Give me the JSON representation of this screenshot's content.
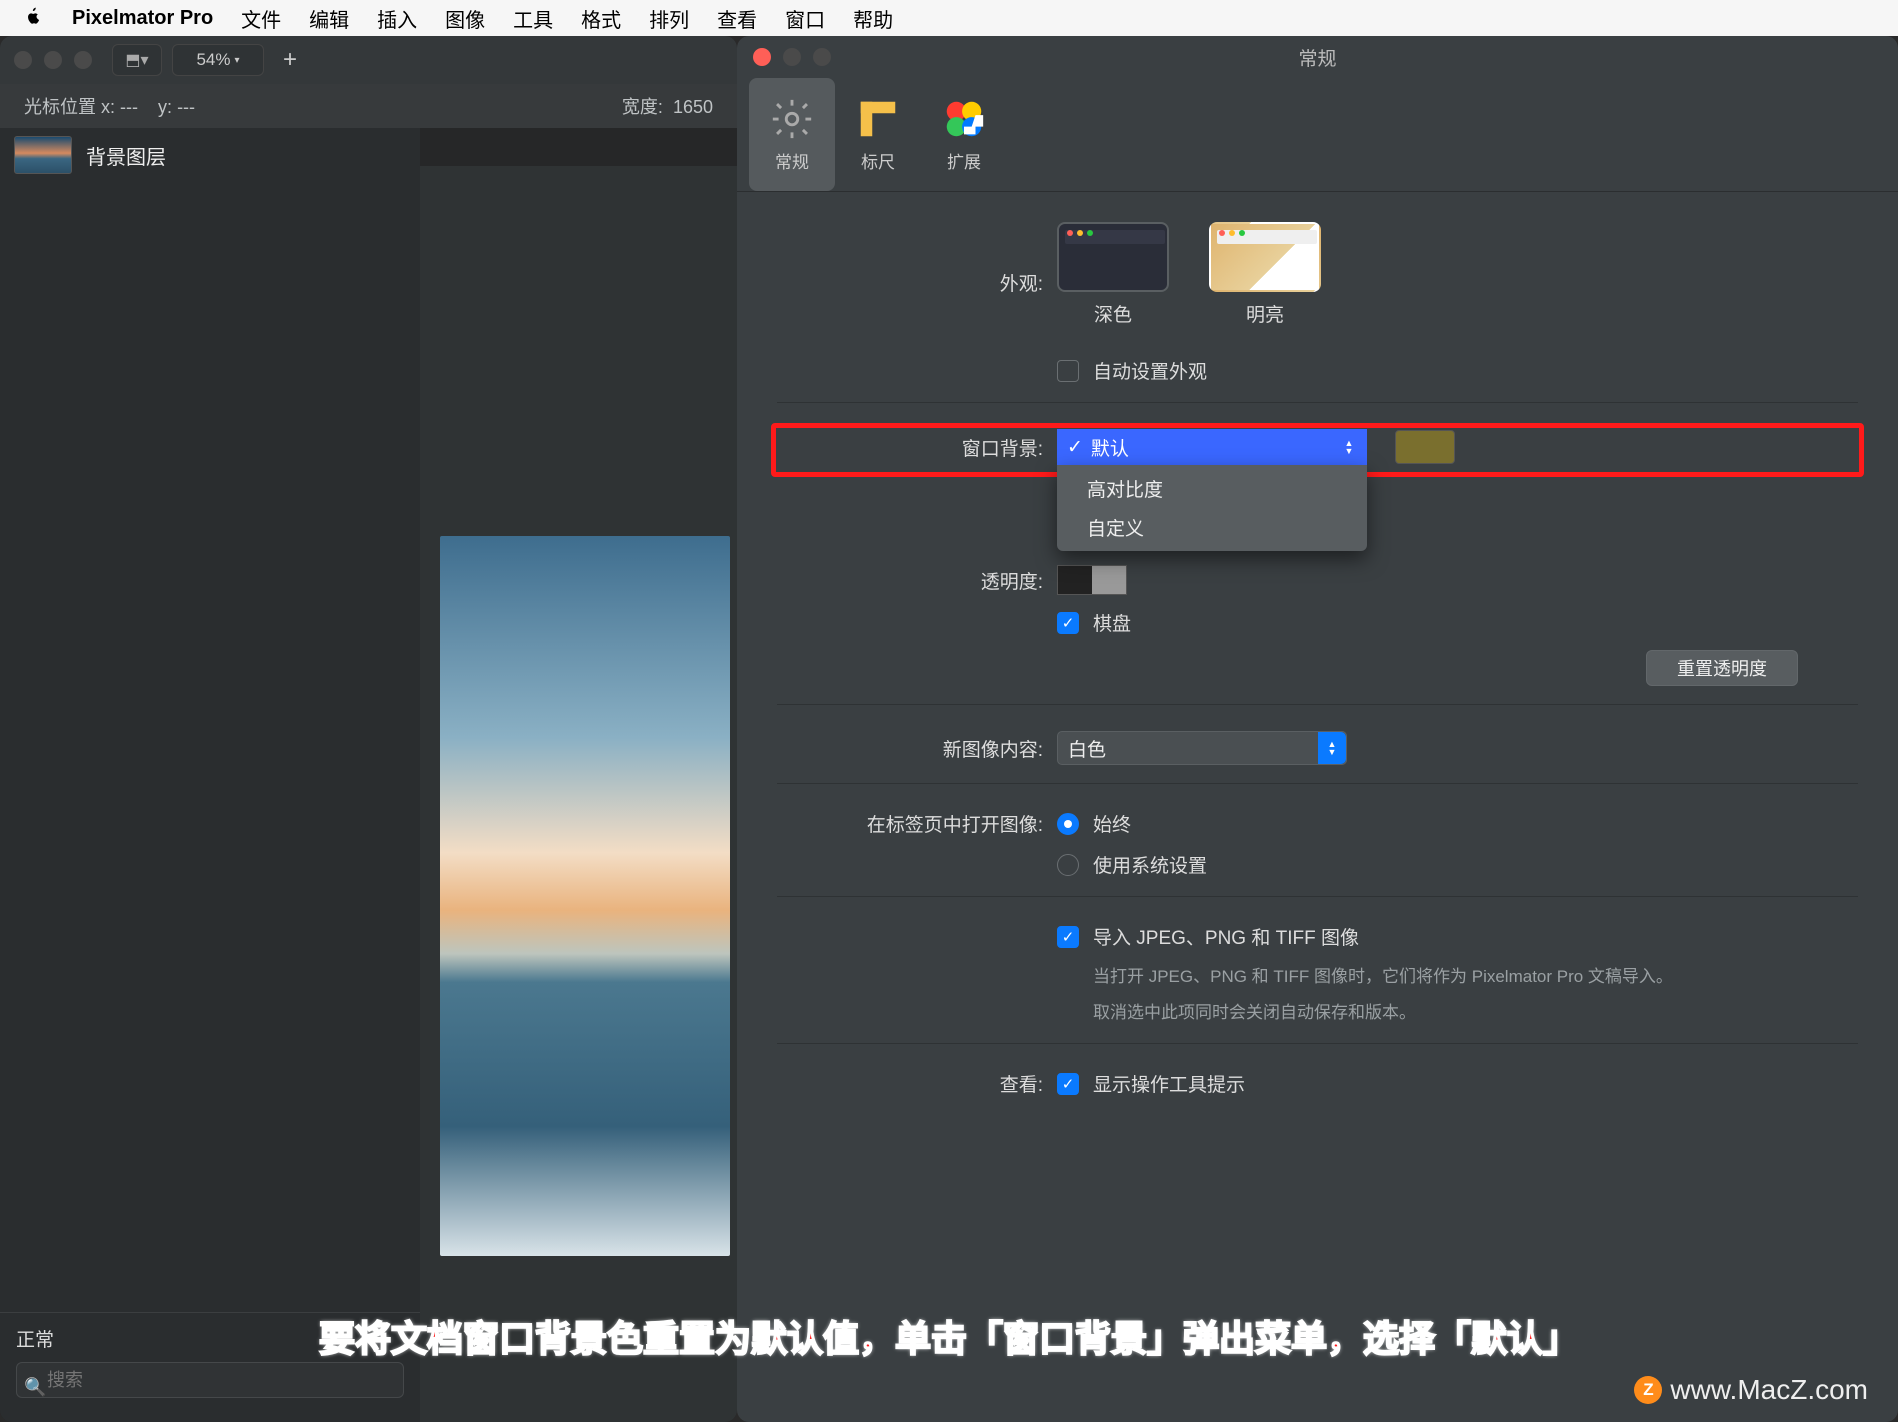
{
  "menubar": {
    "app": "Pixelmator Pro",
    "items": [
      "文件",
      "编辑",
      "插入",
      "图像",
      "工具",
      "格式",
      "排列",
      "查看",
      "窗口",
      "帮助"
    ]
  },
  "appwin": {
    "zoom": "54%",
    "infobar": {
      "cursor_label": "光标位置 x:",
      "cursor_x": "---",
      "cursor_ysep": "y:",
      "cursor_y": "---",
      "width_label": "宽度:",
      "width": "1650"
    },
    "layer": "背景图层",
    "blend": "正常",
    "search_placeholder": "搜索"
  },
  "pref": {
    "title": "常规",
    "tabs": {
      "general": "常规",
      "ruler": "标尺",
      "ext": "扩展"
    },
    "appearance": {
      "label": "外观:",
      "dark": "深色",
      "light": "明亮",
      "auto": "自动设置外观"
    },
    "winbg": {
      "label": "窗口背景:",
      "options": [
        "默认",
        "高对比度",
        "自定义"
      ],
      "selected": "默认"
    },
    "transparency": {
      "label": "透明度:",
      "checker": "棋盘",
      "reset": "重置透明度"
    },
    "newimage": {
      "label": "新图像内容:",
      "value": "白色"
    },
    "opentabs": {
      "label": "在标签页中打开图像:",
      "always": "始终",
      "system": "使用系统设置"
    },
    "import": {
      "label": "导入 JPEG、PNG 和 TIFF 图像",
      "desc1": "当打开 JPEG、PNG 和 TIFF 图像时，它们将作为 Pixelmator Pro 文稿导入。",
      "desc2": "取消选中此项同时会关闭自动保存和版本。"
    },
    "view": {
      "label": "查看:",
      "tooltips": "显示操作工具提示"
    }
  },
  "caption": "要将文档窗口背景色重置为默认值，单击「窗口背景」弹出菜单，选择「默认」",
  "watermark": "www.MacZ.com"
}
